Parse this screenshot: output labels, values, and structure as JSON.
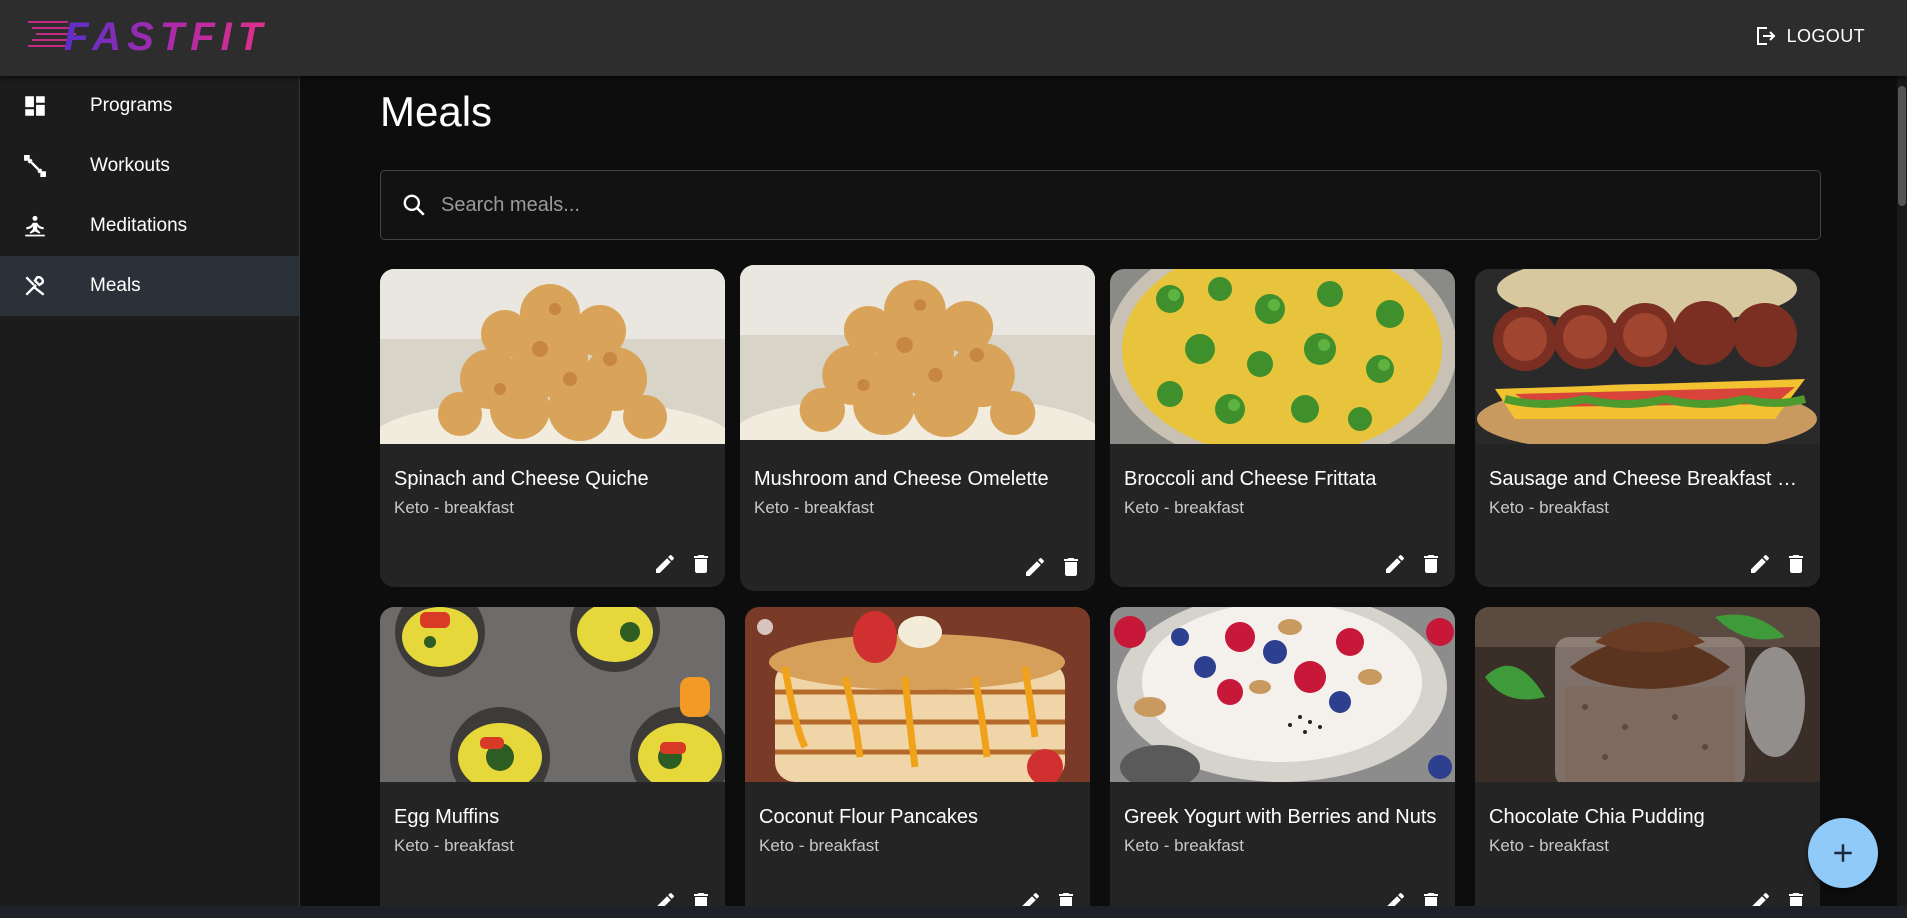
{
  "app": {
    "logo_text": "FASTFIT",
    "logout_label": "LOGOUT"
  },
  "sidebar": {
    "items": [
      {
        "label": "Programs",
        "icon": "dashboard-icon"
      },
      {
        "label": "Workouts",
        "icon": "fitness-icon"
      },
      {
        "label": "Meditations",
        "icon": "self-improvement-icon"
      },
      {
        "label": "Meals",
        "icon": "restaurant-icon",
        "active": true
      }
    ]
  },
  "page": {
    "title": "Meals",
    "search_placeholder": "Search meals..."
  },
  "meals": [
    {
      "title": "Spinach and Cheese Quiche",
      "subtitle": "Keto - breakfast",
      "image": "cauliflower"
    },
    {
      "title": "Mushroom and Cheese Omelette",
      "subtitle": "Keto - breakfast",
      "image": "cauliflower"
    },
    {
      "title": "Broccoli and Cheese Frittata",
      "subtitle": "Keto - breakfast",
      "image": "frittata"
    },
    {
      "title": "Sausage and Cheese Breakfast Sandwich",
      "subtitle": "Keto - breakfast",
      "image": "sausage"
    },
    {
      "title": "Egg Muffins",
      "subtitle": "Keto - breakfast",
      "image": "muffins"
    },
    {
      "title": "Coconut Flour Pancakes",
      "subtitle": "Keto - breakfast",
      "image": "pancakes"
    },
    {
      "title": "Greek Yogurt with Berries and Nuts",
      "subtitle": "Keto - breakfast",
      "image": "yogurt"
    },
    {
      "title": "Chocolate Chia Pudding",
      "subtitle": "Keto - breakfast",
      "image": "pudding"
    }
  ],
  "colors": {
    "accent": "#90caf9",
    "logo_start": "#5b2fc9",
    "logo_end": "#e0308a",
    "active_nav": "#2b3138"
  }
}
